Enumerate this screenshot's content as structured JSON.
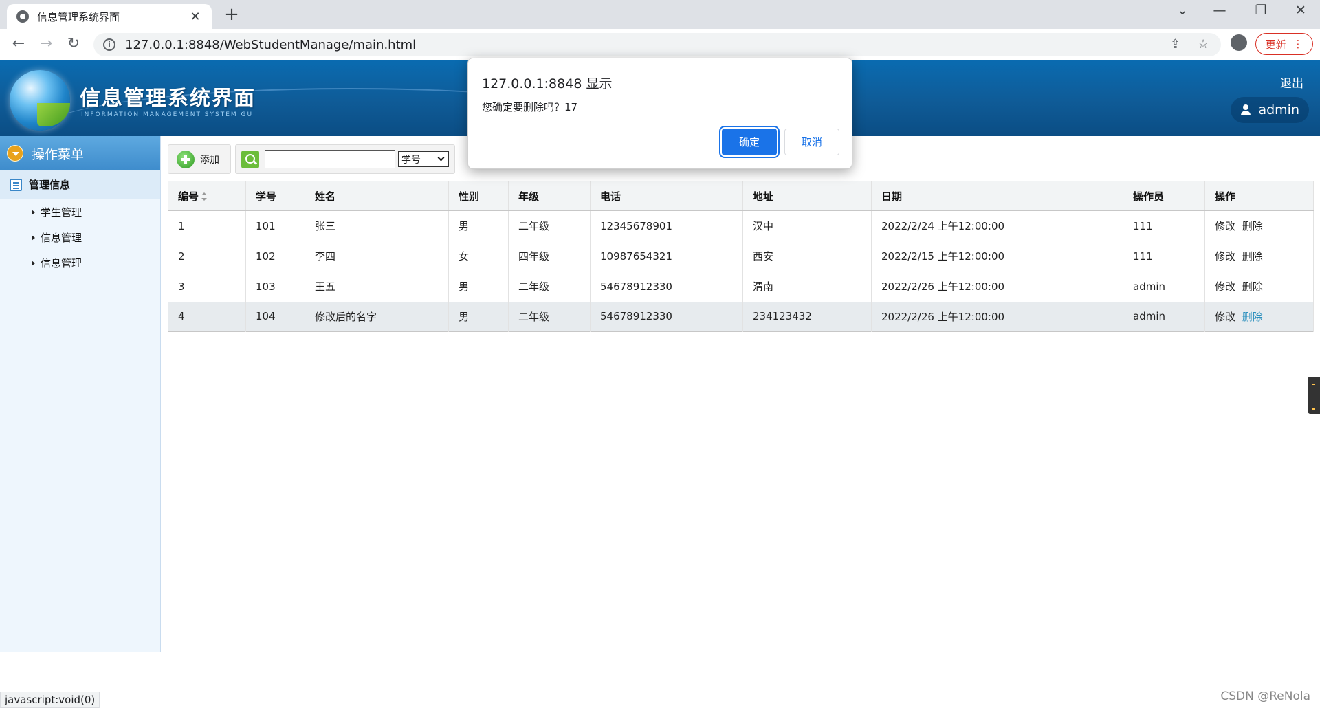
{
  "browser": {
    "tab_title": "信息管理系统界面",
    "url": "127.0.0.1:8848/WebStudentManage/main.html",
    "update_label": "更新",
    "status_text": "javascript:void(0)"
  },
  "header": {
    "title": "信息管理系统界面",
    "subtitle": "INFORMATION MANAGEMENT SYSTEM GUI",
    "logout": "退出",
    "user": "admin"
  },
  "sidebar": {
    "menu_title": "操作菜单",
    "section": "管理信息",
    "items": [
      {
        "label": "学生管理"
      },
      {
        "label": "信息管理"
      },
      {
        "label": "信息管理"
      }
    ]
  },
  "toolbar": {
    "add_label": "添加",
    "search_value": "",
    "select_value": "学号"
  },
  "table": {
    "headers": [
      "编号",
      "学号",
      "姓名",
      "性别",
      "年级",
      "电话",
      "地址",
      "日期",
      "操作员",
      "操作"
    ],
    "rows": [
      {
        "id": "1",
        "sno": "101",
        "name": "张三",
        "gender": "男",
        "grade": "二年级",
        "phone": "12345678901",
        "address": "汉中",
        "date": "2022/2/24 上午12:00:00",
        "operator": "111",
        "edit": "修改",
        "delete": "删除"
      },
      {
        "id": "2",
        "sno": "102",
        "name": "李四",
        "gender": "女",
        "grade": "四年级",
        "phone": "10987654321",
        "address": "西安",
        "date": "2022/2/15 上午12:00:00",
        "operator": "111",
        "edit": "修改",
        "delete": "删除"
      },
      {
        "id": "3",
        "sno": "103",
        "name": "王五",
        "gender": "男",
        "grade": "二年级",
        "phone": "54678912330",
        "address": "渭南",
        "date": "2022/2/26 上午12:00:00",
        "operator": "admin",
        "edit": "修改",
        "delete": "删除"
      },
      {
        "id": "4",
        "sno": "104",
        "name": "修改后的名字",
        "gender": "男",
        "grade": "二年级",
        "phone": "54678912330",
        "address": "234123432",
        "date": "2022/2/26 上午12:00:00",
        "operator": "admin",
        "edit": "修改",
        "delete": "删除"
      }
    ]
  },
  "dialog": {
    "title": "127.0.0.1:8848 显示",
    "message": "您确定要删除吗？17",
    "ok": "确定",
    "cancel": "取消"
  },
  "watermark": "CSDN @ReNola",
  "colors": {
    "header_blue": "#0f5b97",
    "primary_button": "#1a73e8",
    "sidebar_bg": "#eef6fd",
    "delete_hover": "#2a8fbd"
  }
}
